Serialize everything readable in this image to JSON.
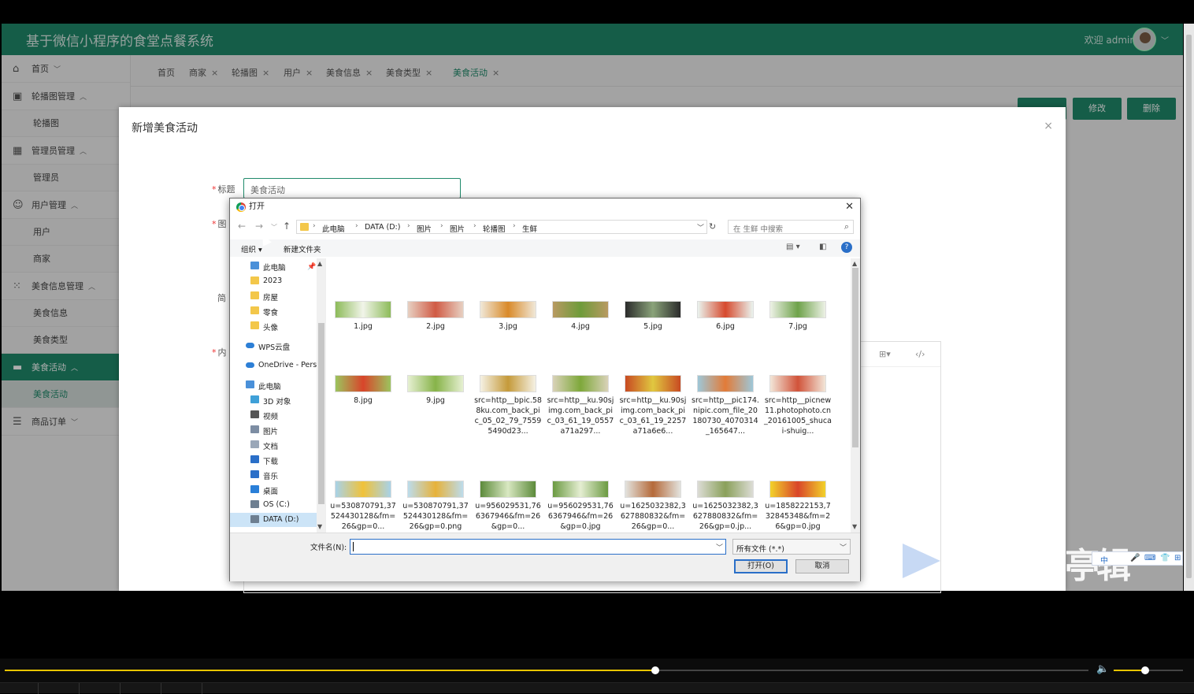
{
  "app": {
    "title": "基于微信小程序的食堂点餐系统",
    "welcome": "欢迎 admin",
    "accent_color": "#1f8a6b"
  },
  "sidebar": {
    "groups": [
      {
        "label": "首页",
        "icon": "home-icon",
        "chevron": "﹀",
        "items": []
      },
      {
        "label": "轮播图管理",
        "icon": "image-icon",
        "chevron": "︿",
        "items": [
          "轮播图"
        ]
      },
      {
        "label": "管理员管理",
        "icon": "table-icon",
        "chevron": "︿",
        "items": [
          "管理员"
        ]
      },
      {
        "label": "用户管理",
        "icon": "user-icon",
        "chevron": "︿",
        "items": [
          "用户",
          "商家"
        ]
      },
      {
        "label": "美食信息管理",
        "icon": "grid-icon",
        "chevron": "︿",
        "items": [
          "美食信息",
          "美食类型"
        ]
      },
      {
        "label": "美食活动",
        "icon": "briefcase-icon",
        "chevron": "︿",
        "items": [
          "美食活动"
        ],
        "active": true
      },
      {
        "label": "商品订单",
        "icon": "order-icon",
        "chevron": "﹀",
        "items": []
      }
    ]
  },
  "tabs": [
    {
      "label": "首页",
      "closable": false
    },
    {
      "label": "商家",
      "closable": true
    },
    {
      "label": "轮播图",
      "closable": true
    },
    {
      "label": "用户",
      "closable": true
    },
    {
      "label": "美食信息",
      "closable": true
    },
    {
      "label": "美食类型",
      "closable": true
    },
    {
      "label": "美食活动",
      "closable": true,
      "active": true
    }
  ],
  "page_buttons": {
    "edit": "修改",
    "delete": "删除"
  },
  "modal": {
    "title": "新增美食活动",
    "close": "×",
    "fields": {
      "title_label": "标题",
      "title_value": "美食活动",
      "image_label": "图",
      "intro_label": "简",
      "content_label": "内"
    },
    "editor_tools": [
      "⊞▾",
      "‹/›"
    ]
  },
  "dialog": {
    "title": "打开",
    "close": "✕",
    "path": [
      "此电脑",
      "DATA (D:)",
      "图片",
      "图片",
      "轮播图",
      "生鲜"
    ],
    "search_placeholder": "在 生鲜 中搜索",
    "commands": {
      "organize": "组织 ▾",
      "new_folder": "新建文件夹",
      "help": "?"
    },
    "nav": [
      {
        "label": "此电脑",
        "icon": "pc",
        "indent": 1
      },
      {
        "label": "2023",
        "icon": "folder",
        "indent": 1
      },
      {
        "label": "房屋",
        "icon": "folder",
        "indent": 1
      },
      {
        "label": "零食",
        "icon": "folder",
        "indent": 1
      },
      {
        "label": "头像",
        "icon": "folder",
        "indent": 1
      },
      {
        "label": "WPS云盘",
        "icon": "cloud",
        "indent": 0
      },
      {
        "label": "OneDrive - Pers",
        "icon": "cloud",
        "indent": 0
      },
      {
        "label": "此电脑",
        "icon": "pc",
        "indent": 0
      },
      {
        "label": "3D 对象",
        "icon": "3d",
        "indent": 1
      },
      {
        "label": "视频",
        "icon": "video",
        "indent": 1
      },
      {
        "label": "图片",
        "icon": "picture",
        "indent": 1
      },
      {
        "label": "文档",
        "icon": "doc",
        "indent": 1
      },
      {
        "label": "下载",
        "icon": "download",
        "indent": 1
      },
      {
        "label": "音乐",
        "icon": "music",
        "indent": 1
      },
      {
        "label": "桌面",
        "icon": "desktop",
        "indent": 1
      },
      {
        "label": "OS (C:)",
        "icon": "drive",
        "indent": 1
      },
      {
        "label": "DATA (D:)",
        "icon": "drive",
        "indent": 1,
        "selected": true
      }
    ],
    "files": [
      {
        "name": "1.jpg",
        "c1": "#8dbb5a",
        "c2": "#f1f4e9"
      },
      {
        "name": "2.jpg",
        "c1": "#e7d0c2",
        "c2": "#d05b45"
      },
      {
        "name": "3.jpg",
        "c1": "#f0e8d8",
        "c2": "#d98a2a"
      },
      {
        "name": "4.jpg",
        "c1": "#b89a62",
        "c2": "#6e9b3a"
      },
      {
        "name": "5.jpg",
        "c1": "#2b2b2b",
        "c2": "#8aa37a"
      },
      {
        "name": "6.jpg",
        "c1": "#eaf3ee",
        "c2": "#d64a2e"
      },
      {
        "name": "7.jpg",
        "c1": "#edf1e6",
        "c2": "#6ea24a"
      },
      {
        "name": "8.jpg",
        "c1": "#9cc45e",
        "c2": "#d8452a"
      },
      {
        "name": "9.jpg",
        "c1": "#e6f0d2",
        "c2": "#87b349"
      },
      {
        "name": "src=http__bpic.588ku.com_back_pic_05_02_79_75595490d23...",
        "c1": "#f5f1e4",
        "c2": "#c59a3a"
      },
      {
        "name": "src=http__ku.90sjimg.com_back_pic_03_61_19_0557a71a297...",
        "c1": "#d9d2b8",
        "c2": "#7ea83a"
      },
      {
        "name": "src=http__ku.90sjimg.com_back_pic_03_61_19_2257a71a6e6...",
        "c1": "#c84a22",
        "c2": "#e0c840"
      },
      {
        "name": "src=http__pic174.nipic.com_file_20180730_4070314_165647...",
        "c1": "#9ec7d8",
        "c2": "#e27b38"
      },
      {
        "name": "src=http__picnew11.photophoto.cn_20161005_shucai-shuig...",
        "c1": "#f2e6d8",
        "c2": "#d1533a"
      },
      {
        "name": "u=530870791,37524430128&fm=26&gp=0...",
        "c1": "#a8d2e8",
        "c2": "#f0c23a"
      },
      {
        "name": "u=530870791,37524430128&fm=26&gp=0.png",
        "c1": "#bcdcec",
        "c2": "#e7b23a"
      },
      {
        "name": "u=956029531,766367946&fm=26&gp=0...",
        "c1": "#5c8a3a",
        "c2": "#d9e8c2"
      },
      {
        "name": "u=956029531,766367946&fm=26&gp=0.jpg",
        "c1": "#6b9a42",
        "c2": "#e5eed2"
      },
      {
        "name": "u=1625032382,3627880832&fm=26&gp=0...",
        "c1": "#e3e3de",
        "c2": "#b56a3a"
      },
      {
        "name": "u=1625032382,3627880832&fm=26&gp=0.jp...",
        "c1": "#dcdcd5",
        "c2": "#8aa05a"
      },
      {
        "name": "u=1858222153,732845348&fm=26&gp=0.jpg",
        "c1": "#f2d22a",
        "c2": "#d9452a"
      }
    ],
    "filename_label": "文件名(N):",
    "filename_value": "",
    "filetype_value": "所有文件 (*.*)",
    "open_button": "打开(O)",
    "cancel_button": "取消"
  },
  "overlay_text": {
    "watermark": "亭辑"
  },
  "ime": [
    "中",
    "🎤",
    "⌨",
    "👕",
    "⊞"
  ],
  "player": {
    "progress": 0.6,
    "volume": 0.45
  }
}
